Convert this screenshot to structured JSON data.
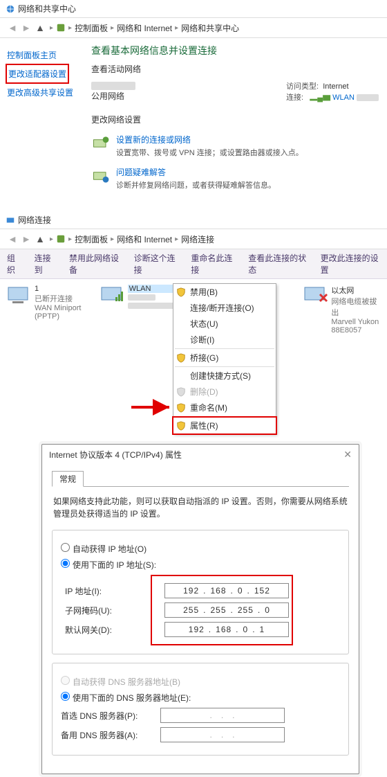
{
  "window1": {
    "title": "网络和共享中心",
    "crumbs": [
      "控制面板",
      "网络和 Internet",
      "网络和共享中心"
    ]
  },
  "p1": {
    "left": {
      "home": "控制面板主页",
      "adapter": "更改适配器设置",
      "advanced": "更改高级共享设置"
    },
    "heading": "查看基本网络信息并设置连接",
    "active_label": "查看活动网络",
    "public_net": "公用网络",
    "access_type_label": "访问类型:",
    "access_type_value": "Internet",
    "conn_label": "连接:",
    "conn_value": "WLAN",
    "change_net": "更改网络设置",
    "link1_title": "设置新的连接或网络",
    "link1_desc": "设置宽带、拨号或 VPN 连接；或设置路由器或接入点。",
    "link2_title": "问题疑难解答",
    "link2_desc": "诊断并修复网络问题，或者获得疑难解答信息。"
  },
  "window2": {
    "title": "网络连接",
    "crumbs": [
      "控制面板",
      "网络和 Internet",
      "网络连接"
    ]
  },
  "toolbar2": [
    "组织",
    "连接到",
    "禁用此网络设备",
    "诊断这个连接",
    "重命名此连接",
    "查看此连接的状态",
    "更改此连接的设置"
  ],
  "conns": [
    {
      "name": "1",
      "sub1": "已断开连接",
      "sub2": "WAN Miniport (PPTP)"
    },
    {
      "name": "WLAN",
      "sub1": "",
      "sub2": ""
    },
    {
      "name": "以太网",
      "sub1": "网络电缆被拔出",
      "sub2": "Marvell Yukon 88E8057"
    }
  ],
  "ctx": {
    "disable": "禁用(B)",
    "conn": "连接/断开连接(O)",
    "status": "状态(U)",
    "diag": "诊断(I)",
    "bridge": "桥接(G)",
    "shortcut": "创建快捷方式(S)",
    "delete": "删除(D)",
    "rename": "重命名(M)",
    "props": "属性(R)"
  },
  "dlg": {
    "title": "Internet 协议版本 4 (TCP/IPv4) 属性",
    "tab": "常规",
    "intro": "如果网络支持此功能，则可以获取自动指派的 IP 设置。否则，你需要从网络系统管理员处获得适当的 IP 设置。",
    "auto_ip": "自动获得 IP 地址(O)",
    "manual_ip": "使用下面的 IP 地址(S):",
    "ip_label": "IP 地址(I):",
    "mask_label": "子网掩码(U):",
    "gw_label": "默认网关(D):",
    "ip": [
      "192",
      "168",
      "0",
      "152"
    ],
    "mask": [
      "255",
      "255",
      "255",
      "0"
    ],
    "gw": [
      "192",
      "168",
      "0",
      "1"
    ],
    "auto_dns": "自动获得 DNS 服务器地址(B)",
    "manual_dns": "使用下面的 DNS 服务器地址(E):",
    "dns1_label": "首选 DNS 服务器(P):",
    "dns2_label": "备用 DNS 服务器(A):"
  }
}
